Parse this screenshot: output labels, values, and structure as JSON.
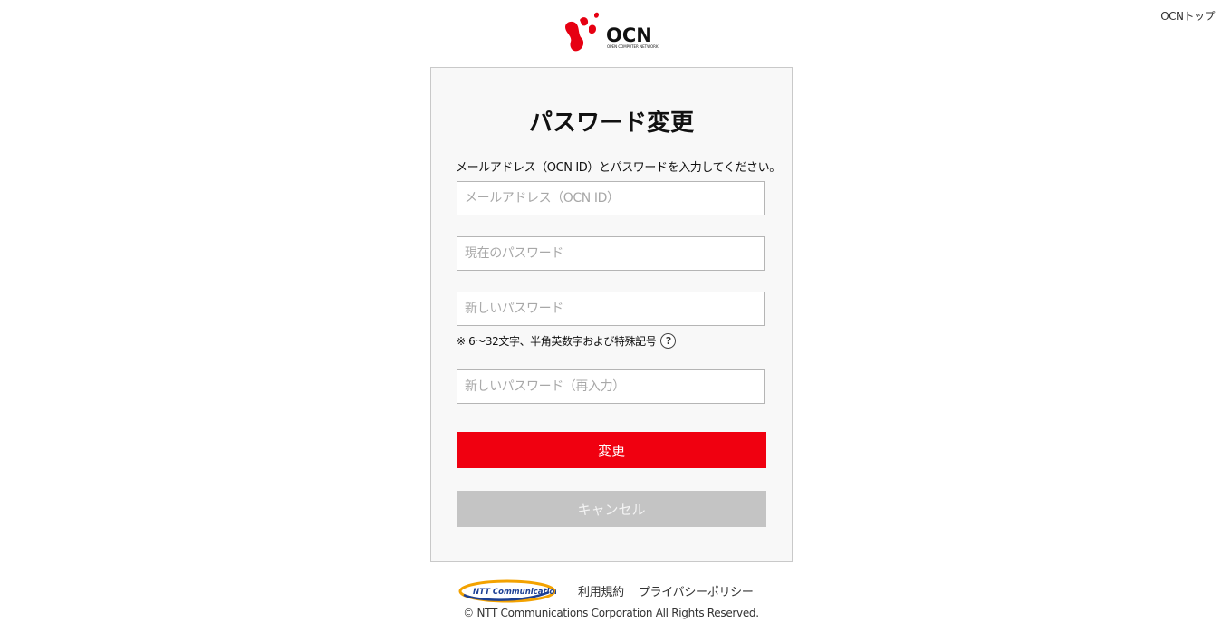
{
  "header": {
    "top_link": "OCNトップ",
    "logo_text": "OCN",
    "logo_subtext": "OPEN COMPUTER NETWORK"
  },
  "form": {
    "title": "パスワード変更",
    "description": "メールアドレス（OCN ID）とパスワードを入力してください。",
    "email_placeholder": "メールアドレス（OCN ID）",
    "current_password_placeholder": "現在のパスワード",
    "new_password_placeholder": "新しいパスワード",
    "password_hint": "※ 6〜32文字、半角英数字および特殊記号",
    "help_symbol": "?",
    "confirm_password_placeholder": "新しいパスワード（再入力）",
    "submit_label": "変更",
    "cancel_label": "キャンセル"
  },
  "footer": {
    "ntt_logo_text": "NTT Communications",
    "terms_link": "利用規約",
    "privacy_link": "プライバシーポリシー",
    "copyright": "© NTT Communications Corporation All Rights Reserved."
  },
  "colors": {
    "brand_red": "#f00010",
    "cancel_gray": "#c4c4c4",
    "card_bg": "#f8f8f8"
  }
}
